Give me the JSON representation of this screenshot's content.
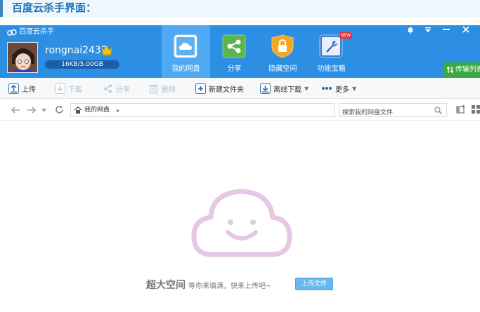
{
  "caption": {
    "text": "百度云杀手界面："
  },
  "app": {
    "brand": "百度云杀手"
  },
  "user": {
    "name": "rongnai2437",
    "quota": "16KB/5.00GB"
  },
  "nav_tabs": [
    {
      "label": "我的网盘",
      "icon": "cloud-drive-icon",
      "active": true
    },
    {
      "label": "分享",
      "icon": "share-icon",
      "active": false
    },
    {
      "label": "隐藏空间",
      "icon": "lock-icon",
      "active": false
    },
    {
      "label": "功能宝箱",
      "icon": "toolbox-icon",
      "active": false,
      "badge": "NEW"
    }
  ],
  "transfer": {
    "label": "传输列表"
  },
  "toolbar": {
    "upload": "上传",
    "download": "下载",
    "share": "分享",
    "delete": "删除",
    "new_folder": "新建文件夹",
    "offline_download": "离线下载",
    "more": "更多"
  },
  "address": {
    "crumb": "我的网盘"
  },
  "search": {
    "placeholder": "搜索我的网盘文件"
  },
  "empty": {
    "headline": "超大空间",
    "subtext": "等你来填满，快来上传吧~",
    "upload_button": "上传文件"
  },
  "colors": {
    "header_blue": "#2c8fe3",
    "active_tab": "#4ea9f2",
    "transfer_green": "#3aa845",
    "cloud_outline": "#e6c7e6"
  }
}
